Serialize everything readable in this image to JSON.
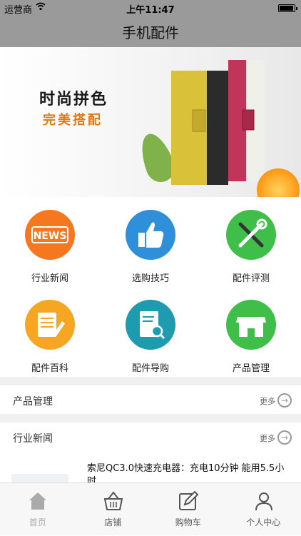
{
  "status_bar": {
    "carrier": "运营商",
    "time": "上午11:47"
  },
  "nav": {
    "title": "手机配件"
  },
  "banner": {
    "slogan_line1": "时尚拼色",
    "slogan_line2": "完美搭配",
    "active_slide": 1,
    "slide_count": 3
  },
  "categories": [
    {
      "label": "行业新闻",
      "icon": "news-icon",
      "color": "#f5771f"
    },
    {
      "label": "选购技巧",
      "icon": "thumbs-up-icon",
      "color": "#2f8fd8"
    },
    {
      "label": "配件评测",
      "icon": "tools-icon",
      "color": "#3fbf4a"
    },
    {
      "label": "配件百科",
      "icon": "encyclopedia-icon",
      "color": "#f5a623"
    },
    {
      "label": "配件导购",
      "icon": "guide-search-icon",
      "color": "#1f9bb0"
    },
    {
      "label": "产品管理",
      "icon": "store-icon",
      "color": "#3fbf4a"
    }
  ],
  "sections": [
    {
      "title": "产品管理",
      "more": "更多"
    },
    {
      "title": "行业新闻",
      "more": "更多"
    }
  ],
  "news_item": {
    "headline": "索尼QC3.0快速充电器：充电10分钟 能用5.5小时"
  },
  "tabbar": [
    {
      "label": "首页",
      "icon": "home-icon",
      "active": true
    },
    {
      "label": "店铺",
      "icon": "basket-icon",
      "active": false
    },
    {
      "label": "购物车",
      "icon": "edit-icon",
      "active": false
    },
    {
      "label": "个人中心",
      "icon": "user-icon",
      "active": false
    }
  ]
}
